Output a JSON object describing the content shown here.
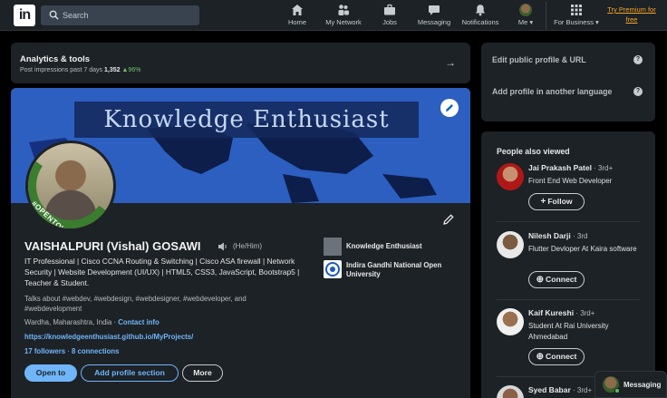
{
  "nav": {
    "search_placeholder": "Search",
    "items": [
      {
        "label": "Home",
        "icon": "home-icon"
      },
      {
        "label": "My Network",
        "icon": "network-icon"
      },
      {
        "label": "Jobs",
        "icon": "briefcase-icon"
      },
      {
        "label": "Messaging",
        "icon": "messaging-icon"
      },
      {
        "label": "Notifications",
        "icon": "bell-icon"
      },
      {
        "label": "Me",
        "icon": "chevron-down-icon"
      },
      {
        "label": "For Business",
        "icon": "grid-icon"
      }
    ],
    "premium": "Try Premium for free"
  },
  "analytics": {
    "title": "Analytics & tools",
    "subtitle_prefix": "Post impressions past 7 days",
    "impressions": "1,352",
    "change": "96%"
  },
  "profile": {
    "banner_text": "Knowledge Enthusiast",
    "open_to_work": "#OPENTOWORK",
    "name": "VAISHALPURI (Vishal) GOSAWI",
    "pronouns": "(He/Him)",
    "headline": "IT Professional | Cisco CCNA Routing & Switching | Cisco ASA firewall | Network Security | Website Development (UI/UX) | HTML5, CSS3, JavaScript, Bootstrap5 | Teacher & Student.",
    "talks_about": "Talks about #webdev, #webdesign, #webdesigner, #webdeveloper, and #webdevelopment",
    "location": "Wardha, Maharashtra, India",
    "location_sep": " · ",
    "contact_info": "Contact info",
    "website": "https://knowledgeenthusiast.github.io/MyProjects/",
    "followers": "17 followers",
    "connections_sep": " · ",
    "connections": "8 connections",
    "buttons": {
      "open_to": "Open to",
      "add_section": "Add profile section",
      "more": "More"
    },
    "orgs": [
      {
        "name": "Knowledge Enthusiast"
      },
      {
        "name": "Indira Gandhi National Open University"
      }
    ]
  },
  "side": {
    "edit_url": "Edit public profile & URL",
    "add_language": "Add profile in another language",
    "help_glyph": "?",
    "people_title": "People also viewed",
    "people": [
      {
        "name": "Jai Prakash Patel",
        "degree": " · 3rd+",
        "title": "Front End Web Developer",
        "action": "Follow",
        "glyph": "+"
      },
      {
        "name": "Nilesh Darji",
        "degree": " · 3rd",
        "title": "Flutter Devloper At Kaira software",
        "action": "Connect",
        "glyph": "⊕"
      },
      {
        "name": "Kaif Kureshi",
        "degree": " · 3rd+",
        "title": "Student At Rai University Ahmedabad",
        "action": "Connect",
        "glyph": "⊕"
      },
      {
        "name": "Syed Babar",
        "degree": " · 3rd+",
        "title": "",
        "action": "",
        "glyph": ""
      }
    ]
  },
  "messaging": {
    "label": "Messaging"
  },
  "colors": {
    "background": "#000000",
    "card": "#1d2226",
    "accent": "#70b5f9",
    "premium": "#f5a623",
    "positive": "#6ec46e",
    "banner": "#2f5db4",
    "open_to_work": "#3a7d2f"
  }
}
